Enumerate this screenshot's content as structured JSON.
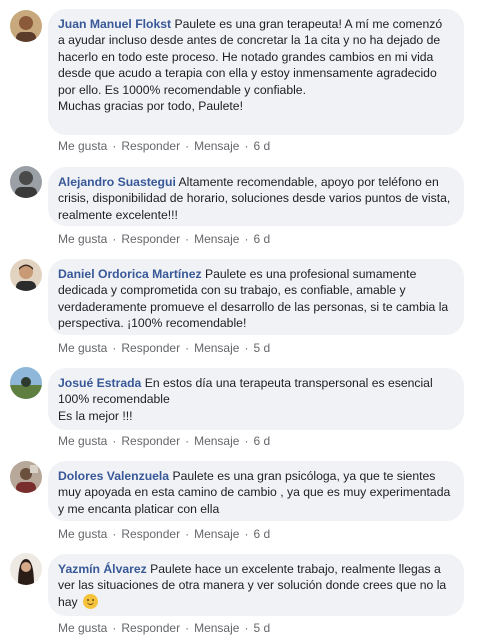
{
  "actions": {
    "like": "Me gusta",
    "reply": "Responder",
    "message": "Mensaje"
  },
  "comments": [
    {
      "author": "Juan Manuel Flokst",
      "text": " Paulete es una gran terapeuta! A mí me comenzó a ayudar incluso desde antes de concretar la 1a cita y no ha dejado de hacerlo en todo este proceso. He notado grandes cambios en mi vida desde que acudo a terapia con ella y estoy inmensamente agradecido por ello. Es 1000% recomendable y confiable.\nMuchas gracias por todo, Paulete!",
      "time": "6 d"
    },
    {
      "author": "Alejandro Suastegui",
      "text": " Altamente recomendable, apoyo por teléfono en crisis, disponibilidad de horario, soluciones desde varios puntos de vista, realmente excelente!!!",
      "time": "6 d"
    },
    {
      "author": "Daniel Ordorica Martínez",
      "text": " Paulete es una profesional sumamente dedicada y comprometida con su trabajo, es confiable, amable y verdaderamente promueve el desarrollo de las personas, si te cambia la perspectiva. ¡100% recomendable!",
      "time": "5 d"
    },
    {
      "author": "Josué Estrada",
      "text": " En estos día una terapeuta transpersonal es esencial 100% recomendable\nEs la mejor !!!",
      "time": "6 d"
    },
    {
      "author": "Dolores Valenzuela",
      "text": " Paulete es una gran psicóloga, ya que te sientes muy apoyada en esta camino de cambio , ya que es muy experimentada y me encanta platicar con ella",
      "time": "6 d"
    },
    {
      "author": "Yazmín Álvarez",
      "text": " Paulete hace un excelente trabajo, realmente llegas a ver las situaciones de otra manera y ver solución donde crees que no la hay ",
      "time": "5 d"
    }
  ]
}
